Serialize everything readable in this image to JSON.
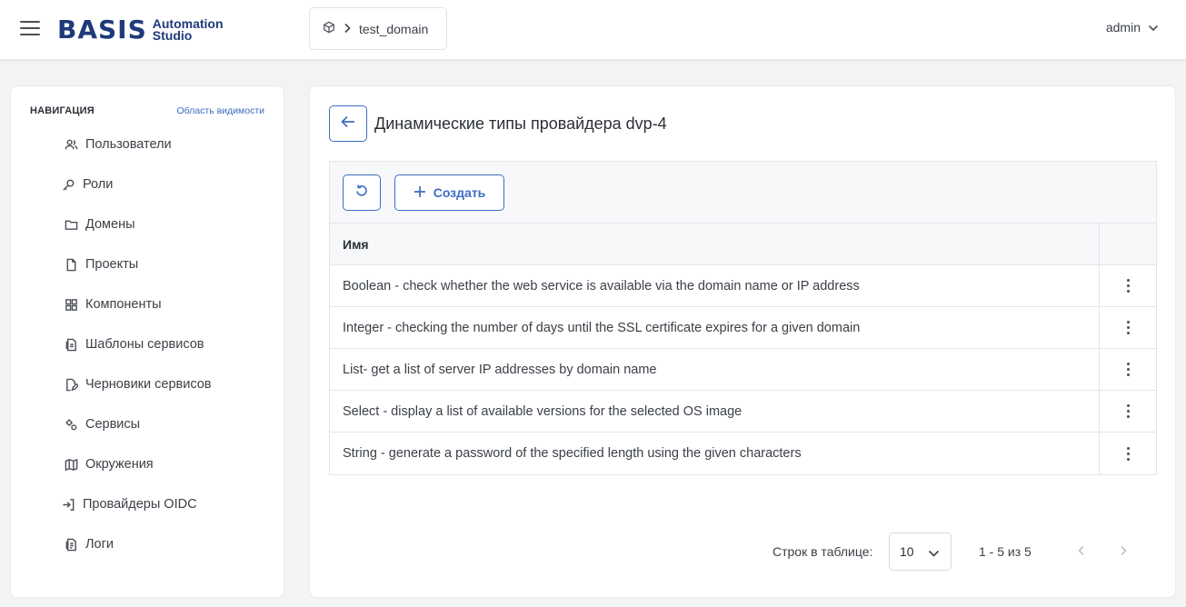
{
  "header": {
    "logo_main": "BASIS",
    "logo_sub": "Automation Studio",
    "breadcrumb": "test_domain",
    "user": "admin"
  },
  "sidebar": {
    "heading": "НАВИГАЦИЯ",
    "scope_link": "Область видимости",
    "items": [
      {
        "label": "Пользователи",
        "icon": "users-icon"
      },
      {
        "label": "Роли",
        "icon": "key-icon"
      },
      {
        "label": "Домены",
        "icon": "folder-icon"
      },
      {
        "label": "Проекты",
        "icon": "file-icon"
      },
      {
        "label": "Компоненты",
        "icon": "grid-icon"
      },
      {
        "label": "Шаблоны сервисов",
        "icon": "template-icon"
      },
      {
        "label": "Черновики сервисов",
        "icon": "draft-icon"
      },
      {
        "label": "Сервисы",
        "icon": "services-icon"
      },
      {
        "label": "Окружения",
        "icon": "map-icon"
      },
      {
        "label": "Провайдеры OIDC",
        "icon": "login-icon"
      },
      {
        "label": "Логи",
        "icon": "logs-icon"
      }
    ]
  },
  "main": {
    "title": "Динамические типы провайдера dvp-4",
    "create_label": "Создать",
    "column_name": "Имя",
    "rows": [
      "Boolean - check whether the web service is available via the domain name or IP address",
      "Integer - checking the number of days until the SSL certificate expires for a given domain",
      "List- get a list of server IP addresses by domain name",
      "Select - display a list of available versions for the selected OS image",
      "String - generate a password of the specified length using the given characters"
    ],
    "pager": {
      "rows_label": "Строк в таблице:",
      "rows_value": "10",
      "range": "1 - 5 из 5"
    }
  },
  "colors": {
    "accent": "#3b6cc4",
    "logo": "#1f3a7a"
  }
}
